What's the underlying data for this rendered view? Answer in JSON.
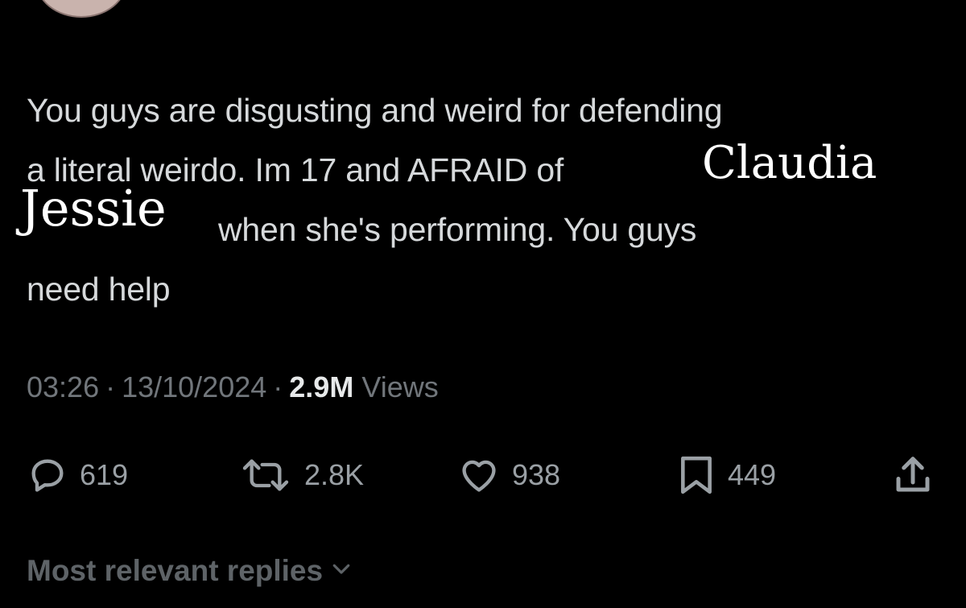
{
  "tweet": {
    "text_lines": [
      "You guys are disgusting and weird for defending",
      "a literal weirdo. Im 17 and AFRAID of",
      "when she's performing. You guys",
      "need help"
    ],
    "overlay_names": {
      "first": "Claudia",
      "second": "Jessie"
    }
  },
  "meta": {
    "time": "03:26",
    "date": "13/10/2024",
    "views_count": "2.9M",
    "views_label": "Views"
  },
  "actions": {
    "replies": "619",
    "retweets": "2.8K",
    "likes": "938",
    "bookmarks": "449"
  },
  "icons": {
    "reply": "reply-bubble-icon",
    "retweet": "retweet-arrows-icon",
    "like": "heart-icon",
    "bookmark": "bookmark-icon",
    "share": "share-upload-icon",
    "chevron": "chevron-down-icon"
  },
  "replies_toggle": {
    "label": "Most relevant replies"
  },
  "colors": {
    "background": "#000000",
    "text": "#d6d9db",
    "muted": "#71767b",
    "icon": "#9aa0a5"
  }
}
